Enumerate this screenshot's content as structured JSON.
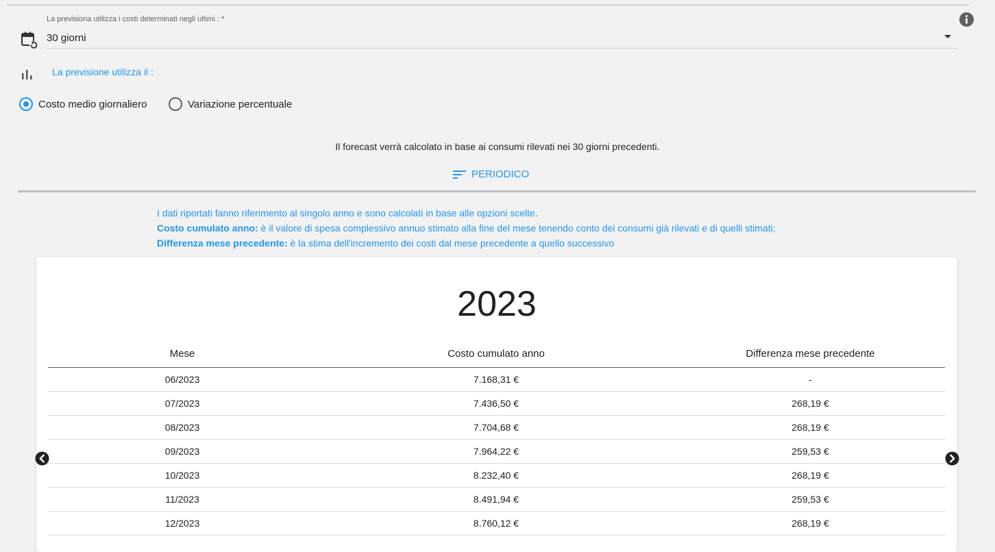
{
  "forecast_settings": {
    "period_label": "La previsiona utilizza i costi determinati negli ultimi : *",
    "period_value": "30 giorni",
    "method_label": "La previsione utilizza il :",
    "options": [
      {
        "label": "Costo medio giornaliero",
        "selected": true
      },
      {
        "label": "Variazione percentuale",
        "selected": false
      }
    ],
    "summary": "Il forecast verrà calcolato in base ai consumi rilevati nei 30 giorni precedenti.",
    "periodico_label": "PERIODICO"
  },
  "notes": {
    "line1": "I dati riportati fanno riferimento al singolo anno e sono calcolati in base alle opzioni scelte.",
    "line2_bold": "Costo cumulato anno:",
    "line2_text": " è il valore di spesa complessivo annuo stimato alla fine del mese tenendo conto dei consumi già rilevati e di quelli stimati;",
    "line3_bold": "Differenza mese precedente:",
    "line3_text": " è la stima dell'incremento dei costi dal mese precedente a quello successivo"
  },
  "table": {
    "year": "2023",
    "headers": [
      "Mese",
      "Costo cumulato anno",
      "Differenza mese precedente"
    ],
    "rows": [
      [
        "06/2023",
        "7.168,31 €",
        "-"
      ],
      [
        "07/2023",
        "7.436,50 €",
        "268,19 €"
      ],
      [
        "08/2023",
        "7.704,68 €",
        "268,19 €"
      ],
      [
        "09/2023",
        "7.964,22 €",
        "259,53 €"
      ],
      [
        "10/2023",
        "8.232,40 €",
        "268,19 €"
      ],
      [
        "11/2023",
        "8.491,94 €",
        "259,53 €"
      ],
      [
        "12/2023",
        "8.760,12 €",
        "268,19 €"
      ]
    ]
  },
  "icons": {
    "info": "info-icon",
    "calendar": "calendar-refresh-icon",
    "chart": "bar-chart-icon",
    "sort": "sort-icon",
    "prev": "chevron-left-circle-icon",
    "next": "chevron-right-circle-icon"
  },
  "colors": {
    "accent": "#2196f3",
    "background": "#f2f2f2",
    "card": "#ffffff",
    "divider": "#b7bec6"
  }
}
